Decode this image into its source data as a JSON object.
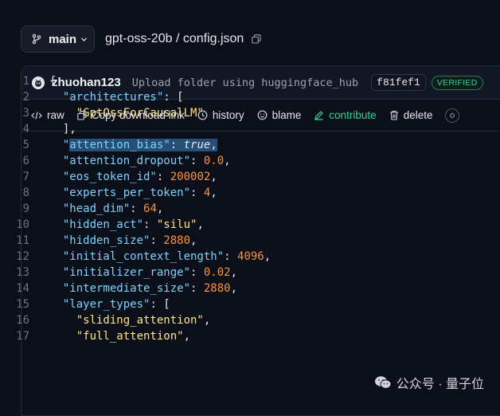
{
  "header": {
    "branch": "main",
    "path": "gpt-oss-20b / config.json"
  },
  "commit": {
    "author": "zhuohan123",
    "message": "Upload folder using huggingface_hub",
    "hash": "f81fef1",
    "badge": "VERIFIED"
  },
  "toolbar": {
    "raw": "raw",
    "copy_link": "Copy download link",
    "history": "history",
    "blame": "blame",
    "contribute": "contribute",
    "delete": "delete"
  },
  "code_lines": [
    {
      "n": "1",
      "parts": [
        [
          "p",
          "{"
        ]
      ]
    },
    {
      "n": "2",
      "parts": [
        [
          "p",
          "  "
        ],
        [
          "k",
          "\"architectures\""
        ],
        [
          "p",
          ": ["
        ]
      ]
    },
    {
      "n": "3",
      "parts": [
        [
          "p",
          "    "
        ],
        [
          "s",
          "\"GptOssForCausalLM\""
        ]
      ]
    },
    {
      "n": "4",
      "parts": [
        [
          "p",
          "  ],"
        ]
      ]
    },
    {
      "n": "5",
      "parts": [
        [
          "p",
          "  "
        ],
        [
          "k",
          "\""
        ],
        [
          "khl",
          "attention_bias"
        ],
        [
          "khl",
          "\""
        ],
        [
          "phl",
          ": "
        ],
        [
          "bhl",
          "true"
        ],
        [
          "phl",
          ","
        ]
      ]
    },
    {
      "n": "6",
      "parts": [
        [
          "p",
          "  "
        ],
        [
          "k",
          "\"attention_dropout\""
        ],
        [
          "p",
          ": "
        ],
        [
          "n",
          "0.0"
        ],
        [
          "p",
          ","
        ]
      ]
    },
    {
      "n": "7",
      "parts": [
        [
          "p",
          "  "
        ],
        [
          "k",
          "\"eos_token_id\""
        ],
        [
          "p",
          ": "
        ],
        [
          "n",
          "200002"
        ],
        [
          "p",
          ","
        ]
      ]
    },
    {
      "n": "8",
      "parts": [
        [
          "p",
          "  "
        ],
        [
          "k",
          "\"experts_per_token\""
        ],
        [
          "p",
          ": "
        ],
        [
          "n",
          "4"
        ],
        [
          "p",
          ","
        ]
      ]
    },
    {
      "n": "9",
      "parts": [
        [
          "p",
          "  "
        ],
        [
          "k",
          "\"head_dim\""
        ],
        [
          "p",
          ": "
        ],
        [
          "n",
          "64"
        ],
        [
          "p",
          ","
        ]
      ]
    },
    {
      "n": "10",
      "parts": [
        [
          "p",
          "  "
        ],
        [
          "k",
          "\"hidden_act\""
        ],
        [
          "p",
          ": "
        ],
        [
          "s",
          "\"silu\""
        ],
        [
          "p",
          ","
        ]
      ]
    },
    {
      "n": "11",
      "parts": [
        [
          "p",
          "  "
        ],
        [
          "k",
          "\"hidden_size\""
        ],
        [
          "p",
          ": "
        ],
        [
          "n",
          "2880"
        ],
        [
          "p",
          ","
        ]
      ]
    },
    {
      "n": "12",
      "parts": [
        [
          "p",
          "  "
        ],
        [
          "k",
          "\"initial_context_length\""
        ],
        [
          "p",
          ": "
        ],
        [
          "n",
          "4096"
        ],
        [
          "p",
          ","
        ]
      ]
    },
    {
      "n": "13",
      "parts": [
        [
          "p",
          "  "
        ],
        [
          "k",
          "\"initializer_range\""
        ],
        [
          "p",
          ": "
        ],
        [
          "n",
          "0.02"
        ],
        [
          "p",
          ","
        ]
      ]
    },
    {
      "n": "14",
      "parts": [
        [
          "p",
          "  "
        ],
        [
          "k",
          "\"intermediate_size\""
        ],
        [
          "p",
          ": "
        ],
        [
          "n",
          "2880"
        ],
        [
          "p",
          ","
        ]
      ]
    },
    {
      "n": "15",
      "parts": [
        [
          "p",
          "  "
        ],
        [
          "k",
          "\"layer_types\""
        ],
        [
          "p",
          ": ["
        ]
      ]
    },
    {
      "n": "16",
      "parts": [
        [
          "p",
          "    "
        ],
        [
          "s",
          "\"sliding_attention\""
        ],
        [
          "p",
          ","
        ]
      ]
    },
    {
      "n": "17",
      "parts": [
        [
          "p",
          "    "
        ],
        [
          "s",
          "\"full_attention\""
        ],
        [
          "p",
          ","
        ]
      ]
    }
  ],
  "watermark": "公众号 · 量子位",
  "colors": {
    "accent_green": "#34d399",
    "key_blue": "#7dd3fc",
    "string_yellow": "#fde68a",
    "number_orange": "#fb923c",
    "selection": "#264f78"
  }
}
